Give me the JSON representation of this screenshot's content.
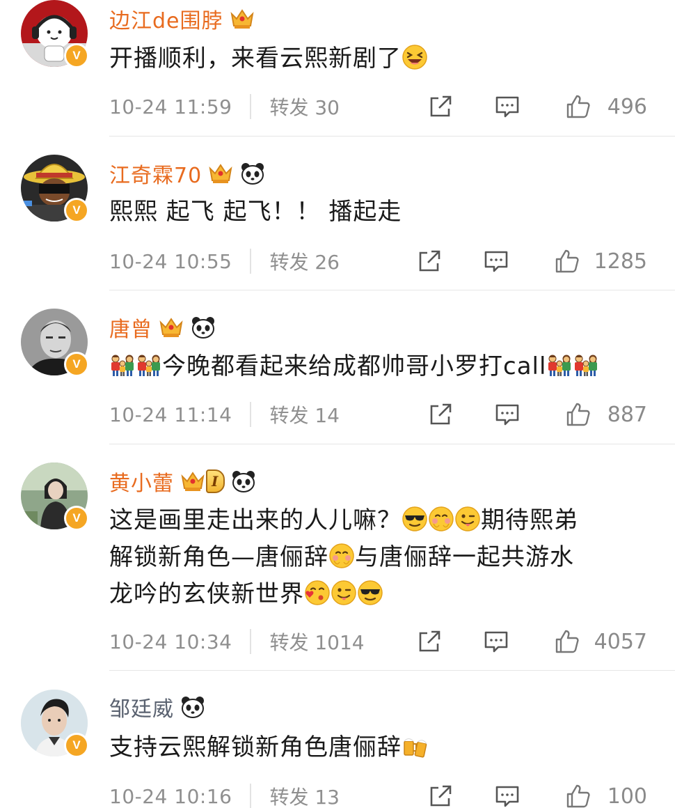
{
  "comments": [
    {
      "username": "边江de围脖",
      "text": "开播顺利，来看云熙新剧了",
      "time": "10-24 11:59",
      "repost": "转发 30",
      "likes": "496"
    },
    {
      "username": "江奇霖70",
      "text": "熙熙 起飞 起飞！！ 播起走",
      "time": "10-24 10:55",
      "repost": "转发 26",
      "likes": "1285"
    },
    {
      "username": "唐曾",
      "text": "今晚都看起来给成都帅哥小罗打call",
      "time": "10-24 11:14",
      "repost": "转发 14",
      "likes": "887"
    },
    {
      "username": "黄小蕾",
      "level_badge": "I",
      "text_line1": "这是画里走出来的人儿嘛？",
      "text_line1b": "期待熙弟",
      "text_line2a": "解锁新角色—唐俪辞",
      "text_line2b": "与唐俪辞一起共游水",
      "text_line3": "龙吟的玄侠新世界",
      "time": "10-24 10:34",
      "repost": "转发 1014",
      "likes": "4057"
    },
    {
      "username": "邹廷威",
      "text": "支持云熙解锁新角色唐俪辞",
      "time": "10-24 10:16",
      "repost": "转发 13",
      "likes": "100"
    }
  ],
  "icons": {
    "verified": "V",
    "repost_icon": "share-icon",
    "comment_icon": "comment-icon",
    "like_icon": "thumbs-up-icon"
  },
  "colors": {
    "vip_name": "#e86b1f",
    "plain_name": "#5a6270",
    "verified_badge": "#f5a623"
  }
}
